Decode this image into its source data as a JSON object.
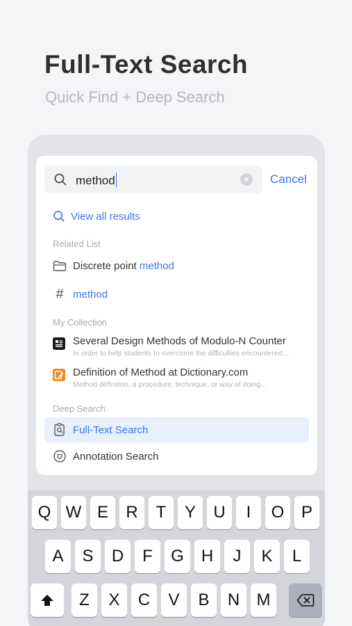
{
  "headline": "Full-Text Search",
  "subline": "Quick Find + Deep Search",
  "search": {
    "query": "method",
    "cancel_label": "Cancel",
    "clear_symbol": "×"
  },
  "view_all_label": "View all results",
  "related": {
    "label": "Related List",
    "folder_item": {
      "prefix": "Discrete point ",
      "highlight": "method",
      "icon": "folder-icon"
    },
    "tag_item": {
      "symbol": "#",
      "label": "method",
      "icon": "hash-icon"
    }
  },
  "collection": {
    "label": "My Collection",
    "items": [
      {
        "title": "Several Design Methods of Modulo-N Counter",
        "desc": "In order to help students to overcome the difficulties encountered...",
        "icon": "document-icon",
        "color": "#1c1c1c"
      },
      {
        "title": "Definition of Method at Dictionary.com",
        "desc": "Method definition, a procedure, technique, or way of doing...",
        "icon": "edit-icon",
        "color": "#f08a24"
      }
    ]
  },
  "deep_search": {
    "label": "Deep Search",
    "items": [
      {
        "label": "Full-Text Search",
        "icon": "search-document-icon",
        "active": true
      },
      {
        "label": "Annotation Search",
        "icon": "annotation-icon",
        "active": false
      }
    ]
  },
  "keyboard": {
    "row1": [
      "Q",
      "W",
      "E",
      "R",
      "T",
      "Y",
      "U",
      "I",
      "O",
      "P"
    ],
    "row2": [
      "A",
      "S",
      "D",
      "F",
      "G",
      "H",
      "J",
      "K",
      "L"
    ],
    "row3": [
      "Z",
      "X",
      "C",
      "V",
      "B",
      "N",
      "M"
    ],
    "shift_icon": "shift-arrow-icon",
    "backspace_icon": "backspace-icon"
  },
  "colors": {
    "accent": "#3a78e7",
    "background": "#f4f5f7",
    "highlight_row": "#e8f0fd"
  }
}
